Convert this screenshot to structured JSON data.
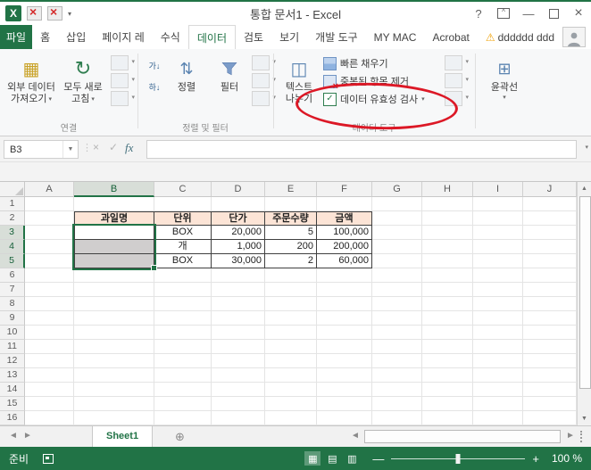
{
  "titlebar": {
    "title": "통합 문서1 - Excel",
    "help": "?",
    "minimize": "—",
    "close": "×"
  },
  "tabs": {
    "file": "파일",
    "items": [
      "홈",
      "삽입",
      "페이지 레",
      "수식",
      "데이터",
      "검토",
      "보기",
      "개발 도구",
      "MY MAC",
      "Acrobat"
    ],
    "active": "데이터",
    "warning_label": "dddddd ddd"
  },
  "ribbon": {
    "external_data_1": "외부 데이터",
    "external_data_2": "가져오기",
    "refresh_1": "모두 새로",
    "refresh_2": "고침",
    "group_connections": "연결",
    "sort": "정렬",
    "filter": "필터",
    "group_sort_filter": "정렬 및 필터",
    "text_cols_1": "텍스트",
    "text_cols_2": "나누기",
    "flash_fill": "빠른 채우기",
    "remove_duplicates": "중복된 항목 제거",
    "data_validation": "데이터 유효성 검사",
    "group_data_tools": "데이터 도구",
    "outline": "윤곽선"
  },
  "annotation": {
    "shape": "ellipse",
    "around": "데이터 유효성 검사",
    "color": "#dc1826"
  },
  "formula_bar": {
    "name_box": "B3",
    "fx": "fx"
  },
  "grid": {
    "columns": [
      "A",
      "B",
      "C",
      "D",
      "E",
      "F",
      "G",
      "H",
      "I",
      "J"
    ],
    "row_count": 16,
    "selection": {
      "column": "B",
      "rows": [
        3,
        4,
        5
      ],
      "active_row": 3,
      "range": "B3:B5",
      "active_cell": "B3"
    },
    "header_fill_row": 2,
    "table_range": "B2:F5",
    "cells": {
      "B2": "과일명",
      "C2": "단위",
      "D2": "단가",
      "E2": "주문수량",
      "F2": "금액",
      "C3": "BOX",
      "D3": "20,000",
      "E3": "5",
      "F3": "100,000",
      "C4": "개",
      "D4": "1,000",
      "E4": "200",
      "F4": "200,000",
      "C5": "BOX",
      "D5": "30,000",
      "E5": "2",
      "F5": "60,000"
    }
  },
  "sheet_bar": {
    "sheet_name": "Sheet1"
  },
  "status_bar": {
    "ready": "준비",
    "zoom": "100 %"
  },
  "colors": {
    "excel_green": "#217346",
    "table_header_fill": "#fce4d6",
    "selection_shade": "#d0cece",
    "annotation_red": "#dc1826"
  }
}
